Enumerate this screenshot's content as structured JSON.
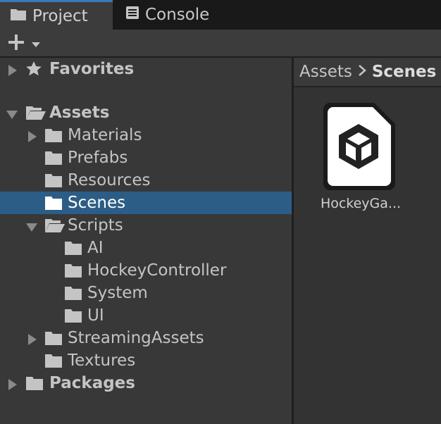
{
  "tabs": [
    {
      "label": "Project",
      "icon": "folder-icon",
      "active": true
    },
    {
      "label": "Console",
      "icon": "console-icon",
      "active": false
    }
  ],
  "toolbar": {
    "add_icon": "plus-dropdown-icon"
  },
  "tree": {
    "favorites": {
      "label": "Favorites",
      "icon": "star-icon"
    },
    "assets": {
      "label": "Assets"
    },
    "materials": {
      "label": "Materials"
    },
    "prefabs": {
      "label": "Prefabs"
    },
    "resources": {
      "label": "Resources"
    },
    "scenes": {
      "label": "Scenes",
      "selected": true
    },
    "scripts": {
      "label": "Scripts"
    },
    "ai": {
      "label": "AI"
    },
    "hockeycontroller": {
      "label": "HockeyController"
    },
    "system": {
      "label": "System"
    },
    "ui": {
      "label": "UI"
    },
    "streamingassets": {
      "label": "StreamingAssets"
    },
    "textures": {
      "label": "Textures"
    },
    "packages": {
      "label": "Packages"
    }
  },
  "breadcrumb": {
    "root": "Assets",
    "current": "Scenes"
  },
  "assets_view": {
    "items": [
      {
        "name": "HockeyGa...",
        "icon": "unity-scene-icon"
      }
    ]
  },
  "colors": {
    "selection": "#2c5d87",
    "tab_accent": "#3a79bb",
    "panel": "#383838"
  }
}
